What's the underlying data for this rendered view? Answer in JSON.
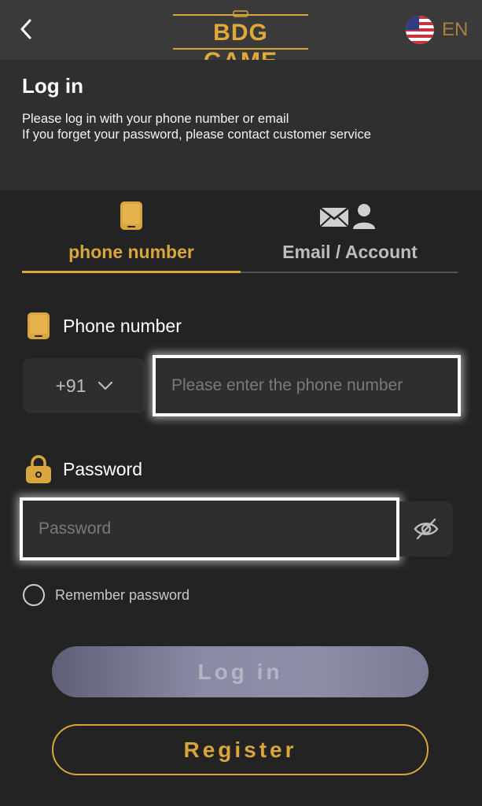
{
  "header": {
    "logo_text": "BDG GAME",
    "language_label": "EN",
    "title": "Log in",
    "description_line1": "Please log in with your phone number or email",
    "description_line2": "If you forget your password, please contact customer service"
  },
  "tabs": [
    {
      "label": "phone number",
      "icon": "phone-icon",
      "active": true
    },
    {
      "label": "Email / Account",
      "icon": "email-account-icon",
      "active": false
    }
  ],
  "phone": {
    "label": "Phone number",
    "country_code": "+91",
    "placeholder": "Please enter the phone number"
  },
  "password": {
    "label": "Password",
    "placeholder": "Password"
  },
  "remember_label": "Remember password",
  "buttons": {
    "login": "Log in",
    "register": "Register"
  },
  "colors": {
    "accent": "#d9a63c",
    "background": "#232323",
    "top_bar": "#3a3a3a",
    "header_block": "#2f2f2f",
    "input_bg": "#2e2e2e"
  }
}
